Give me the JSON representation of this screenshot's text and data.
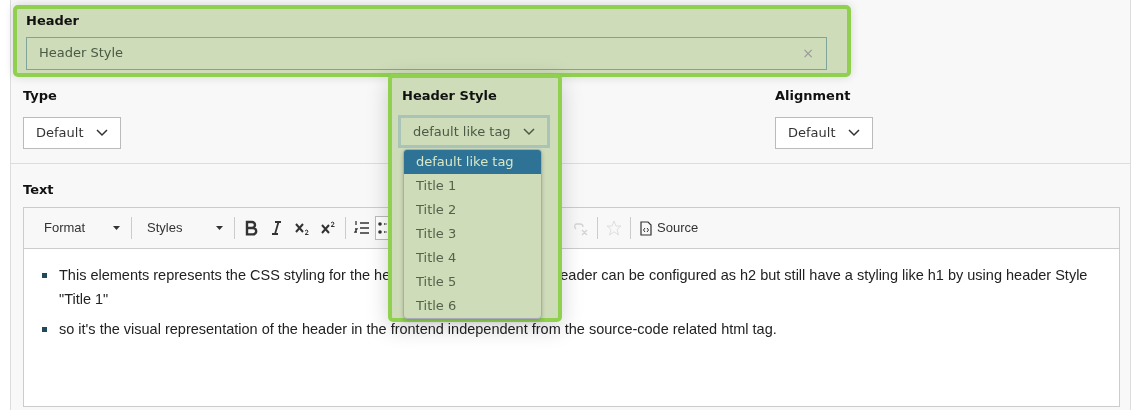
{
  "header_field": {
    "label": "Header",
    "value": "Header Style",
    "clear": "×"
  },
  "selects": [
    {
      "label": "Type",
      "value": "Default",
      "expanded": false
    },
    {
      "label": "Header Style",
      "value": "default like tag",
      "expanded": true,
      "options": [
        {
          "label": "default like tag",
          "selected": true
        },
        {
          "label": "Title 1",
          "selected": false
        },
        {
          "label": "Title 2",
          "selected": false
        },
        {
          "label": "Title 3",
          "selected": false
        },
        {
          "label": "Title 4",
          "selected": false
        },
        {
          "label": "Title 5",
          "selected": false
        },
        {
          "label": "Title 6",
          "selected": false
        }
      ]
    },
    {
      "label": "Alignment",
      "value": "Default",
      "expanded": false
    }
  ],
  "text_section": {
    "label": "Text",
    "toolbar": [
      {
        "kind": "dropdown",
        "label": "Format"
      },
      {
        "kind": "dropdown",
        "label": "Styles"
      },
      {
        "kind": "bold",
        "on": false,
        "disabled": false
      },
      {
        "kind": "italic",
        "on": false,
        "disabled": false
      },
      {
        "kind": "subscript",
        "on": false,
        "disabled": false
      },
      {
        "kind": "superscript",
        "on": false,
        "disabled": false
      },
      {
        "kind": "ordered-list",
        "on": false,
        "disabled": false
      },
      {
        "kind": "bullet-list",
        "on": true,
        "disabled": false
      },
      {
        "kind": "unlink",
        "on": false,
        "disabled": true
      },
      {
        "kind": "star",
        "on": false,
        "disabled": true
      },
      {
        "kind": "source",
        "label": "Source"
      }
    ],
    "bullets": [
      {
        "lines": [
          [
            "This elements represents the CSS styling for the he",
            "eader can be configured as h2 but still have a styling like h1 by using header Style"
          ],
          [
            "\"Title 1\""
          ]
        ]
      },
      {
        "lines": [
          [
            "so it's the visual representation of the header in the frontend independent from the source-code related html tag."
          ]
        ]
      }
    ]
  }
}
